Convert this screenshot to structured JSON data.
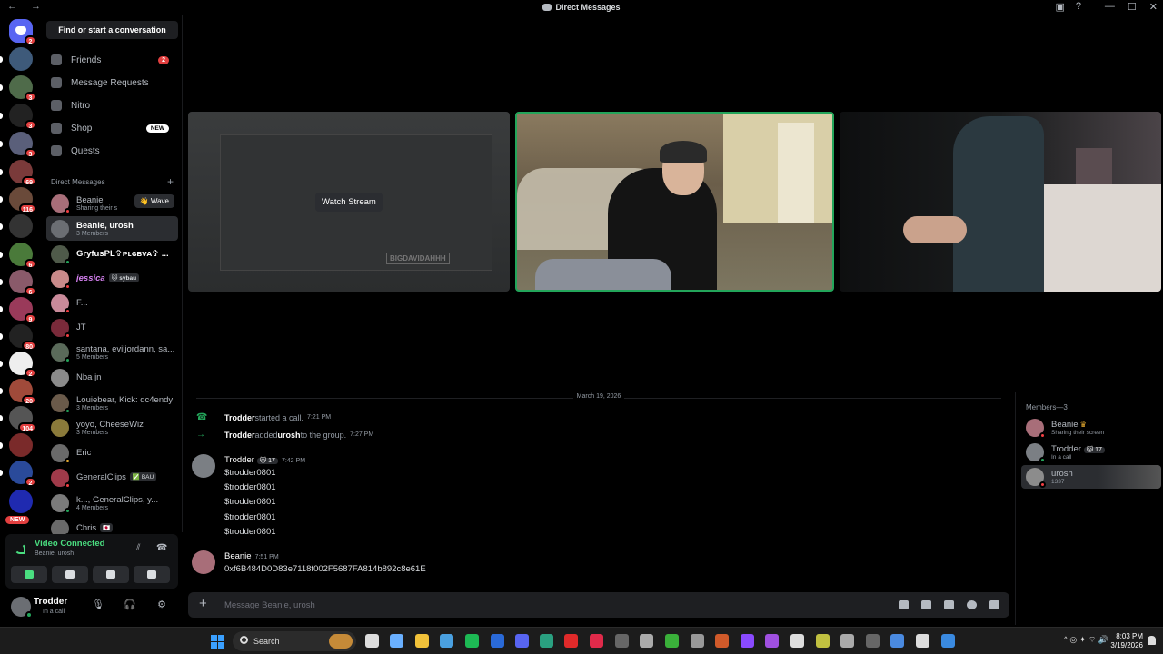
{
  "window": {
    "title": "Direct Messages",
    "nav": "← →",
    "controls": [
      "—",
      "☐",
      "✕"
    ]
  },
  "colors": {
    "accent": "#5865f2",
    "online": "#23a55a",
    "danger": "#e23f3f",
    "speaking": "#23a55a"
  },
  "servers": [
    {
      "name": "discord-home",
      "badge": "2"
    },
    {
      "name": "server-2",
      "badge": ""
    },
    {
      "name": "server-3",
      "badge": "3"
    },
    {
      "name": "server-4",
      "badge": "3"
    },
    {
      "name": "server-5",
      "badge": "3"
    },
    {
      "name": "server-6",
      "badge": "69"
    },
    {
      "name": "server-7",
      "badge": "116"
    },
    {
      "name": "server-8",
      "badge": ""
    },
    {
      "name": "server-9",
      "badge": "6"
    },
    {
      "name": "server-10",
      "badge": "6"
    },
    {
      "name": "server-11",
      "badge": "9"
    },
    {
      "name": "server-12",
      "badge": "80"
    },
    {
      "name": "server-13",
      "badge": "2"
    },
    {
      "name": "server-14",
      "badge": "20"
    },
    {
      "name": "server-15",
      "badge": "104"
    },
    {
      "name": "server-16",
      "badge": ""
    },
    {
      "name": "server-17",
      "badge": "2"
    },
    {
      "name": "server-18",
      "badge": ""
    }
  ],
  "rail_new": "NEW",
  "sidebar": {
    "search": "Find or start a conversation",
    "nav": [
      {
        "label": "Friends",
        "badge": "2",
        "icon": "friends-icon"
      },
      {
        "label": "Message Requests",
        "badge": "",
        "icon": "mail-icon"
      },
      {
        "label": "Nitro",
        "badge": "",
        "icon": "nitro-icon"
      },
      {
        "label": "Shop",
        "new": "NEW",
        "icon": "shop-icon"
      },
      {
        "label": "Quests",
        "badge": "",
        "icon": "quests-icon"
      }
    ],
    "dm_header": "Direct Messages",
    "dm_add": "+",
    "dms": [
      {
        "name": "Beanie",
        "sub": "Sharing their s",
        "wave": "👋 Wave"
      },
      {
        "name": "Beanie, urosh",
        "sub": "3 Members"
      },
      {
        "name": "GryfusPL✞ᴘʟɢʙᴠᴀ✞ ...",
        "sub": ""
      },
      {
        "name": "jessica",
        "tag": "🐱 sybau"
      },
      {
        "name": "F...",
        "sub": ""
      },
      {
        "name": "JT",
        "sub": ""
      },
      {
        "name": "santana, eviljordann, sa...",
        "sub": "5 Members"
      },
      {
        "name": "Nba jn",
        "sub": ""
      },
      {
        "name": "Louiebear, Kick: dc4endy",
        "sub": "3 Members"
      },
      {
        "name": "yoyo, CheeseWiz",
        "sub": "3 Members"
      },
      {
        "name": "Eric",
        "sub": ""
      },
      {
        "name": "GeneralClips",
        "tag": "✅ BAU"
      },
      {
        "name": "k..., GeneralClips, y...",
        "sub": "4 Members"
      },
      {
        "name": "Chris",
        "tag": "🇯🇵"
      }
    ]
  },
  "voice": {
    "status": "Video Connected",
    "channel": "Beanie, urosh"
  },
  "user": {
    "name": "Trodder",
    "status": "In a call"
  },
  "stream": {
    "watch": "Watch Stream",
    "watermark": "BIGDAVIDAHHH"
  },
  "chat": {
    "date": "March 19, 2026",
    "system": [
      {
        "actor": "Trodder",
        "text": " started a call.",
        "target": "",
        "after": "",
        "time": "7:21 PM",
        "icon": "phone-icon"
      },
      {
        "actor": "Trodder",
        "text": " added ",
        "target": "urosh",
        "after": " to the group.",
        "time": "7:27 PM",
        "icon": "arrow-right-icon"
      }
    ],
    "messages": [
      {
        "author": "Trodder",
        "tag": "🐱 17",
        "time": "7:42 PM",
        "lines": [
          "$trodder0801",
          "$trodder0801",
          "$trodder0801",
          "$trodder0801",
          "$trodder0801"
        ]
      },
      {
        "author": "Beanie",
        "tag": "",
        "time": "7:51 PM",
        "lines": [
          "0xf6B484D0D83e7118f002F5687FA814b892c8e61E"
        ]
      }
    ],
    "placeholder": "Message Beanie, urosh",
    "plus": "+"
  },
  "members": {
    "header": "Members—3",
    "list": [
      {
        "name": "Beanie",
        "crown": "♛",
        "sub": "Sharing their screen",
        "tag": ""
      },
      {
        "name": "Trodder",
        "crown": "",
        "sub": "In a call",
        "tag": "🐱 17"
      },
      {
        "name": "urosh",
        "crown": "",
        "sub": "1337",
        "tag": ""
      }
    ]
  },
  "taskbar": {
    "search": "Search",
    "time": "8:03 PM",
    "date": "3/19/2026",
    "tray": "^  ◎  ✦  ⌔  🔊"
  }
}
